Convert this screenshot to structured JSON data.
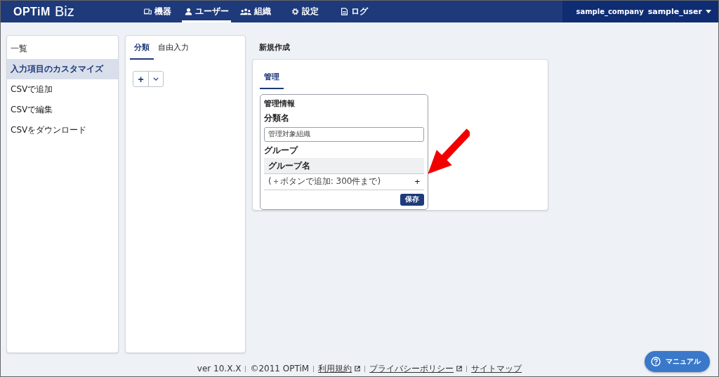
{
  "header": {
    "logo": "OPTiM",
    "logo_suffix": "Biz",
    "nav": [
      {
        "label": "機器",
        "selected": false
      },
      {
        "label": "ユーザー",
        "selected": true
      },
      {
        "label": "組織",
        "selected": false
      },
      {
        "label": "設定",
        "selected": false
      },
      {
        "label": "ログ",
        "selected": false
      }
    ],
    "company": "sample_company",
    "user": "sample_user"
  },
  "sidebar": {
    "items": [
      {
        "label": "一覧",
        "selected": false
      },
      {
        "label": "入力項目のカスタマイズ",
        "selected": true
      },
      {
        "label": "CSVで追加",
        "selected": false
      },
      {
        "label": "CSVで編集",
        "selected": false
      },
      {
        "label": "CSVをダウンロード",
        "selected": false
      }
    ]
  },
  "middle": {
    "tabs": [
      {
        "label": "分類",
        "selected": true
      },
      {
        "label": "自由入力",
        "selected": false
      }
    ],
    "add_button": "+"
  },
  "editor": {
    "title": "新規作成",
    "tabs": [
      {
        "label": "管理",
        "selected": true
      }
    ],
    "section_title": "管理情報",
    "name_label": "分類名",
    "name_value": "管理対象組織",
    "group_label": "グループ",
    "group_header": "グループ名",
    "group_hint": "(＋ボタンで追加: 300件まで)",
    "add_button": "+",
    "save_button": "保存"
  },
  "footer": {
    "version": "ver 10.X.X",
    "copyright": "©2011 OPTiM",
    "links": [
      {
        "label": "利用規約",
        "external": true
      },
      {
        "label": "プライバシーポリシー",
        "external": true
      },
      {
        "label": "サイトマップ",
        "external": false
      }
    ]
  },
  "manual_button": "マニュアル"
}
